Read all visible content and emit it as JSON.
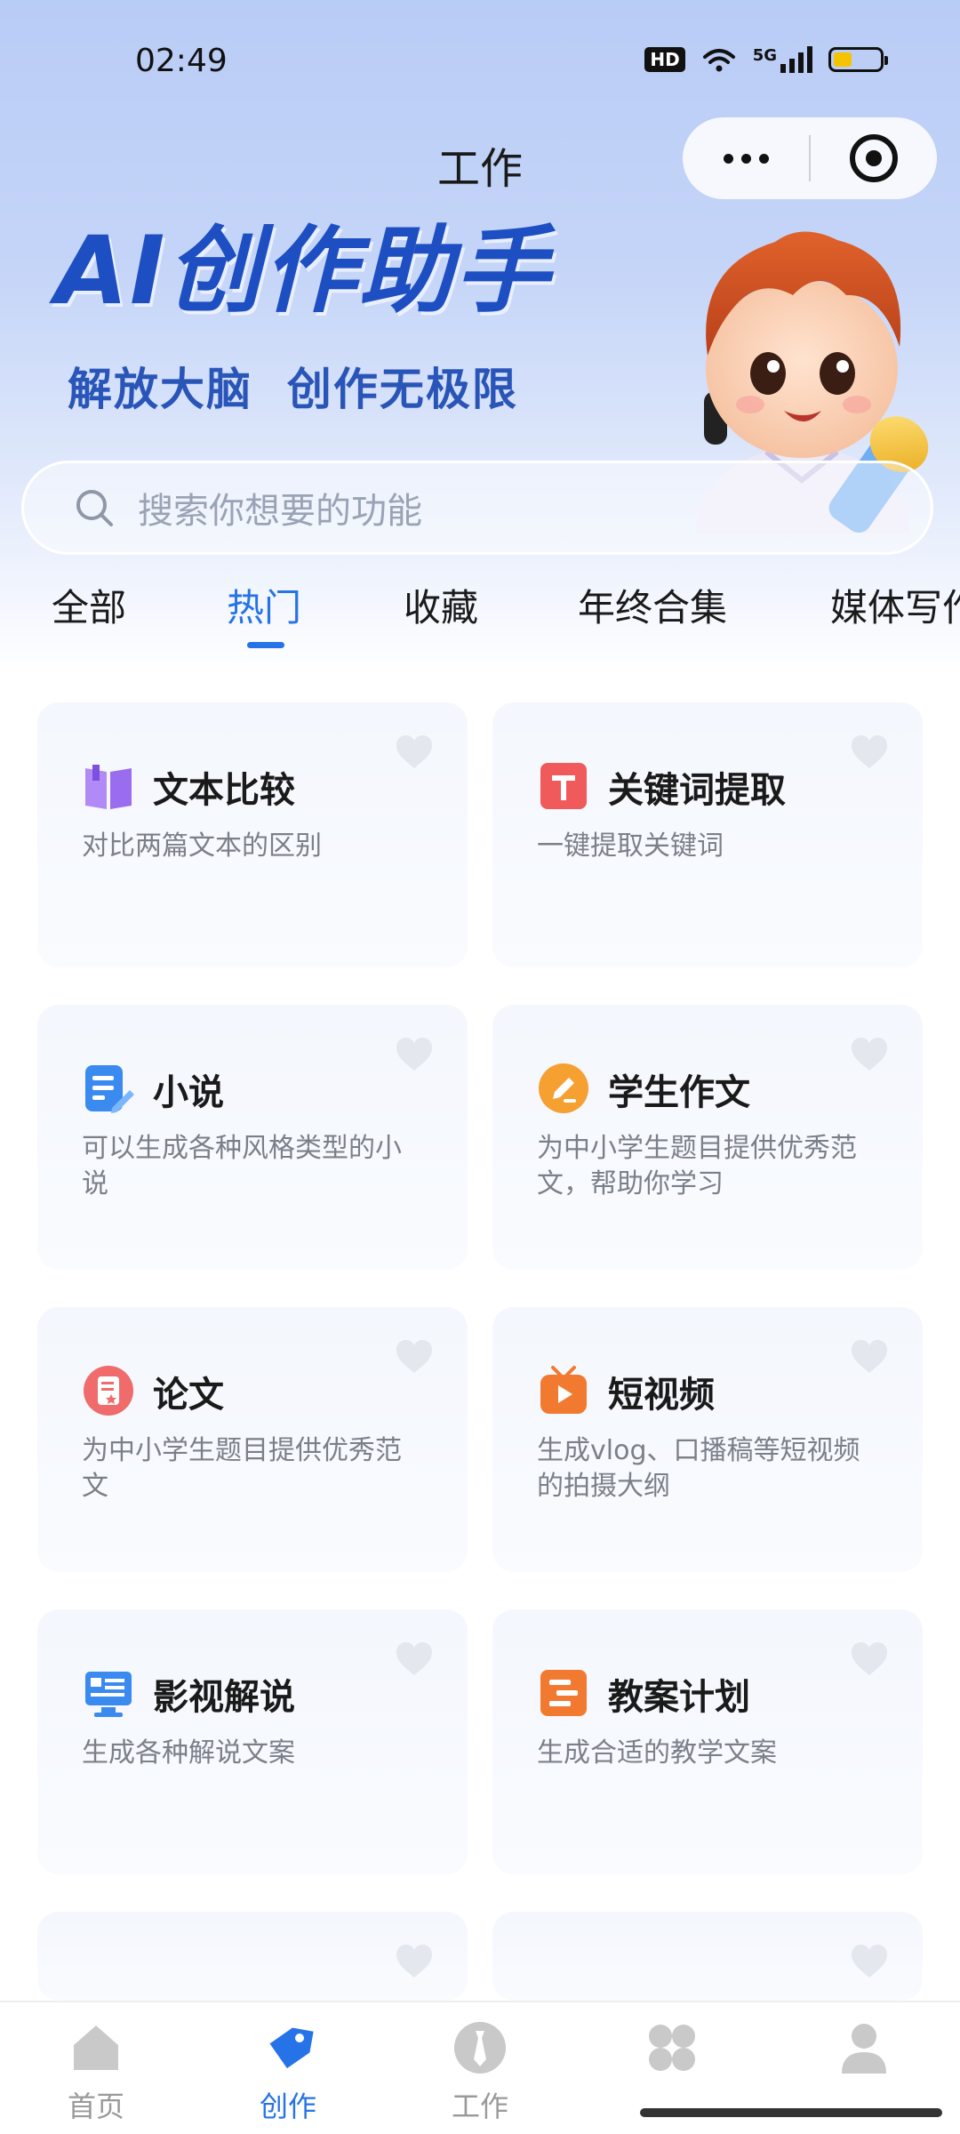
{
  "status_bar": {
    "time": "02:49",
    "network": "5G",
    "hd": "HD",
    "battery_level": 0.4
  },
  "nav": {
    "title": "工作"
  },
  "banner": {
    "title": "AI创作助手",
    "subtitle": "解放大脑  创作无极限"
  },
  "search": {
    "placeholder": "搜索你想要的功能"
  },
  "tabs": [
    {
      "label": "全部",
      "active": false
    },
    {
      "label": "热门",
      "active": true
    },
    {
      "label": "收藏",
      "active": false
    },
    {
      "label": "年终合集",
      "active": false
    },
    {
      "label": "媒体写作",
      "active": false
    }
  ],
  "cards": [
    {
      "title": "文本比较",
      "desc": "对比两篇文本的区别",
      "icon": "book-icon",
      "color": "#9a6cf0"
    },
    {
      "title": "关键词提取",
      "desc": "一键提取关键词",
      "icon": "text-t-icon",
      "color": "#f05a5a"
    },
    {
      "title": "小说",
      "desc": "可以生成各种风格类型的小说",
      "icon": "document-edit-icon",
      "color": "#3a8af0"
    },
    {
      "title": "学生作文",
      "desc": "为中小学生题目提供优秀范文，帮助你学习",
      "icon": "pencil-circle-icon",
      "color": "#f5a030"
    },
    {
      "title": "论文",
      "desc": "为中小学生题目提供优秀范文",
      "icon": "paper-star-icon",
      "color": "#f06b6b"
    },
    {
      "title": "短视频",
      "desc": "生成vlog、口播稿等短视频的拍摄大纲",
      "icon": "tv-play-icon",
      "color": "#f27a30"
    },
    {
      "title": "影视解说",
      "desc": "生成各种解说文案",
      "icon": "monitor-icon",
      "color": "#3a8af0"
    },
    {
      "title": "教案计划",
      "desc": "生成合适的教学文案",
      "icon": "lesson-plan-icon",
      "color": "#f27a30"
    }
  ],
  "bottom_nav": [
    {
      "label": "首页",
      "icon": "home-icon",
      "active": false
    },
    {
      "label": "创作",
      "icon": "create-tag-icon",
      "active": true
    },
    {
      "label": "工作",
      "icon": "tie-icon",
      "active": false
    },
    {
      "label": "",
      "icon": "apps-icon",
      "active": false
    },
    {
      "label": "",
      "icon": "user-icon",
      "active": false
    }
  ],
  "colors": {
    "accent": "#2673e8",
    "banner_title": "#1e4fc2"
  }
}
